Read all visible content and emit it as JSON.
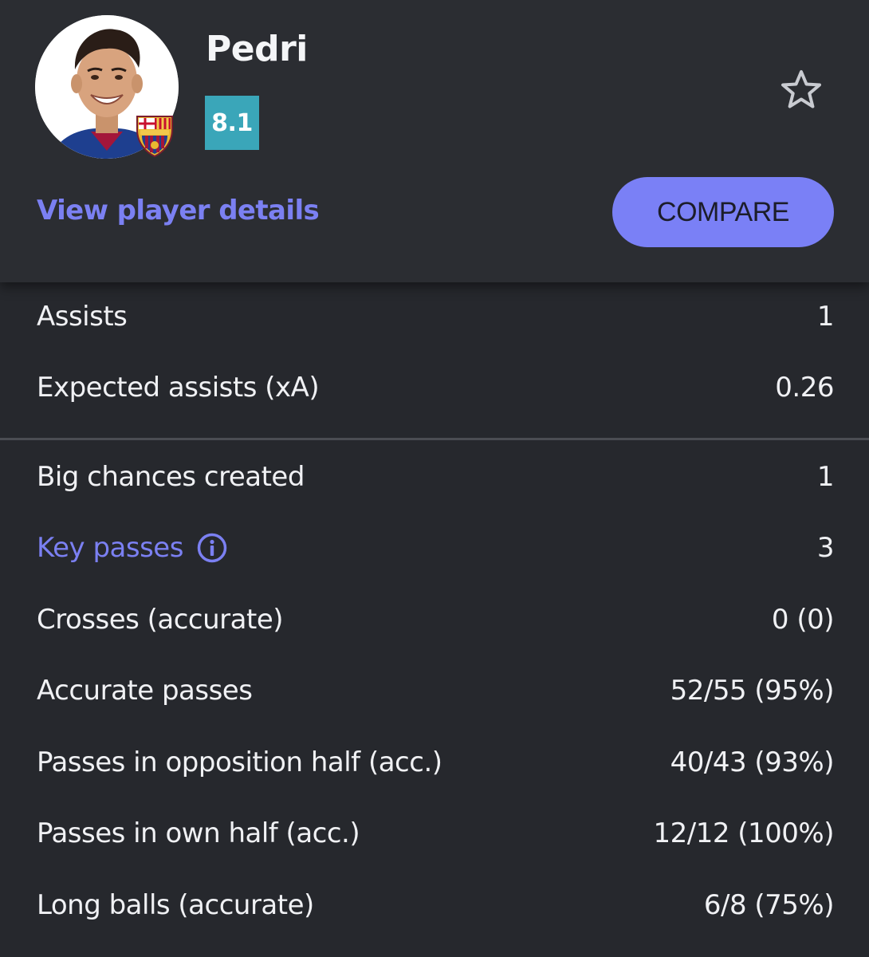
{
  "player": {
    "name": "Pedri",
    "rating": "8.1",
    "view_details_label": "View player details",
    "compare_label": "COMPARE",
    "favorite_icon": "star-outline-icon",
    "team_badge_icon": "fc-barcelona-crest"
  },
  "colors": {
    "rating_bg": "#3aa6b9",
    "accent": "#7b80f2",
    "background": "#26282d"
  },
  "stats": {
    "group1": [
      {
        "label": "Assists",
        "value": "1"
      },
      {
        "label": "Expected assists (xA)",
        "value": "0.26"
      }
    ],
    "group2": [
      {
        "label": "Big chances created",
        "value": "1"
      },
      {
        "label": "Key passes",
        "value": "3",
        "info_icon": "info-circle-icon"
      },
      {
        "label": "Crosses (accurate)",
        "value": "0 (0)"
      },
      {
        "label": "Accurate passes",
        "value": "52/55 (95%)"
      },
      {
        "label": "Passes in opposition half (acc.)",
        "value": "40/43 (93%)"
      },
      {
        "label": "Passes in own half (acc.)",
        "value": "12/12 (100%)"
      },
      {
        "label": "Long balls (accurate)",
        "value": "6/8 (75%)"
      }
    ]
  }
}
